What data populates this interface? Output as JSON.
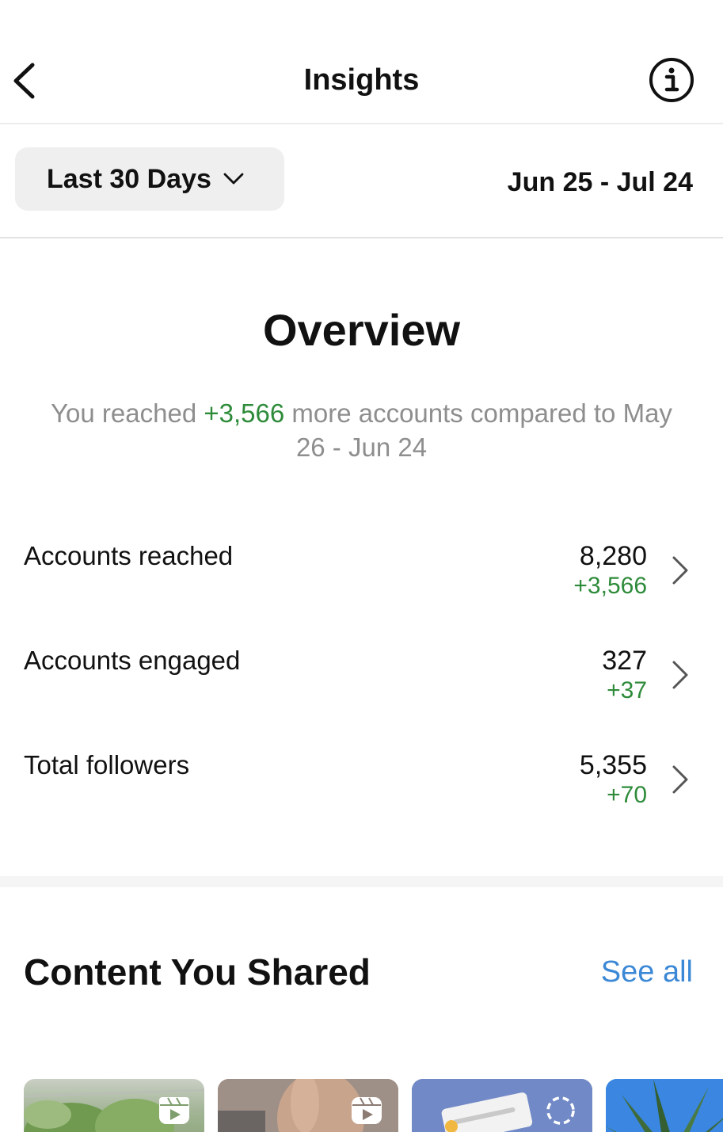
{
  "header": {
    "title": "Insights",
    "back_icon": "chevron-left-icon",
    "info_icon": "info-icon"
  },
  "range": {
    "selected": "Last 30 Days",
    "dates": "Jun 25 - Jul 24"
  },
  "overview": {
    "title": "Overview",
    "summary_prefix": "You reached ",
    "summary_delta": "+3,566",
    "summary_suffix": " more accounts compared to May 26 - Jun 24"
  },
  "metrics": [
    {
      "label": "Accounts reached",
      "value": "8,280",
      "delta": "+3,566"
    },
    {
      "label": "Accounts engaged",
      "value": "327",
      "delta": "+37"
    },
    {
      "label": "Total followers",
      "value": "5,355",
      "delta": "+70"
    }
  ],
  "content": {
    "title": "Content You Shared",
    "see_all": "See all",
    "items": [
      {
        "type": "reel",
        "icon": "reels-icon"
      },
      {
        "type": "reel",
        "icon": "reels-icon"
      },
      {
        "type": "story",
        "icon": "story-ring-icon"
      },
      {
        "type": "post",
        "icon": ""
      }
    ]
  },
  "colors": {
    "positive": "#2e8b3a",
    "link": "#3b88d6",
    "muted": "#8e8e8e"
  }
}
